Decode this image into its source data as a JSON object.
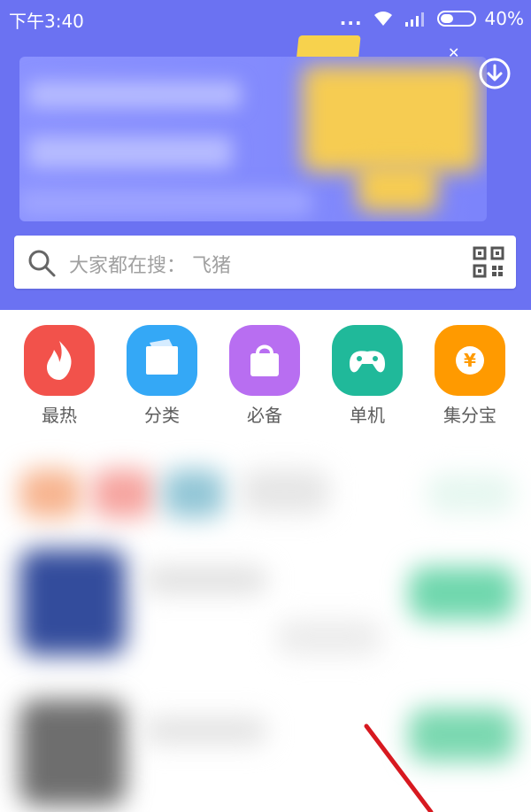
{
  "status_bar": {
    "time": "下午3:40",
    "dots": "...",
    "battery": "40%"
  },
  "search": {
    "placeholder": "大家都在搜：  飞猪"
  },
  "categories": [
    {
      "label": "最热",
      "icon": "fire-icon",
      "color": "#f2524b"
    },
    {
      "label": "分类",
      "icon": "folder-icon",
      "color": "#34a8f6"
    },
    {
      "label": "必备",
      "icon": "bag-icon",
      "color": "#b86ef1"
    },
    {
      "label": "单机",
      "icon": "gamepad-icon",
      "color": "#20b99a"
    },
    {
      "label": "集分宝",
      "icon": "yen-coin-icon",
      "color": "#ff9a00"
    }
  ],
  "colors": {
    "header": "#6b72f2",
    "accent_green": "#6fd7ad",
    "annotation_red": "#d71920"
  }
}
